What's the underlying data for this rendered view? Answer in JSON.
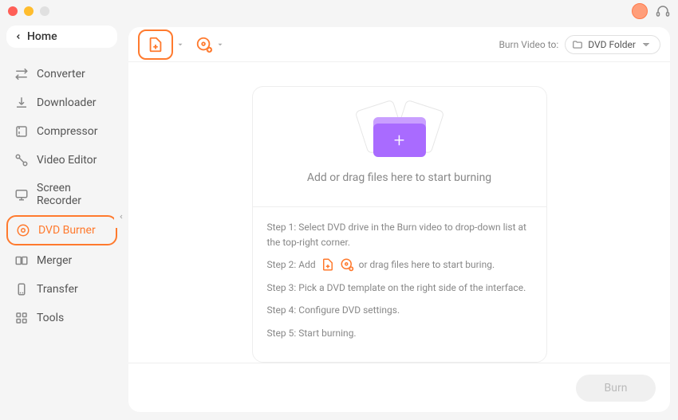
{
  "sidebar": {
    "home": "Home",
    "items": [
      {
        "label": "Converter"
      },
      {
        "label": "Downloader"
      },
      {
        "label": "Compressor"
      },
      {
        "label": "Video Editor"
      },
      {
        "label": "Screen Recorder"
      },
      {
        "label": "DVD Burner"
      },
      {
        "label": "Merger"
      },
      {
        "label": "Transfer"
      },
      {
        "label": "Tools"
      }
    ]
  },
  "toolbar": {
    "burn_to_label": "Burn Video to:",
    "burn_to_value": "DVD Folder"
  },
  "drop": {
    "caption": "Add or drag files here to start burning"
  },
  "steps": {
    "s1": "Step 1: Select DVD drive in the Burn video to drop-down list at the top-right corner.",
    "s2_a": "Step 2: Add",
    "s2_b": "or drag files here to start buring.",
    "s3": "Step 3: Pick a DVD template on the right side of the interface.",
    "s4": "Step 4: Configure DVD settings.",
    "s5": "Step 5: Start burning."
  },
  "footer": {
    "burn": "Burn"
  }
}
